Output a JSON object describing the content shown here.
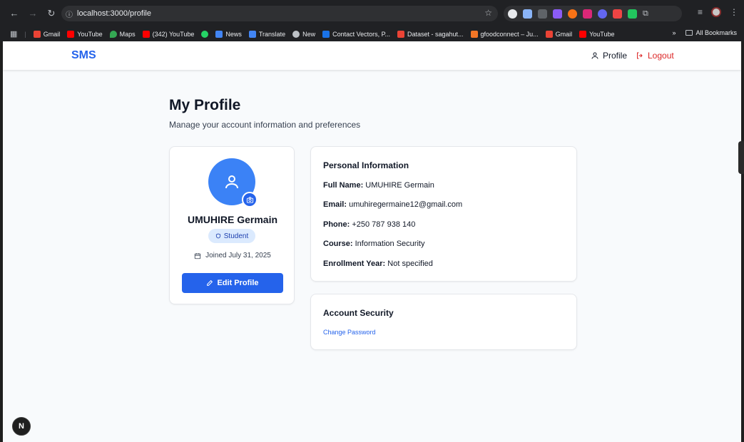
{
  "browser": {
    "url": "localhost:3000/profile",
    "bookmarks": [
      {
        "label": "Gmail",
        "icon": "gmail-icon",
        "color": "#ea4335"
      },
      {
        "label": "YouTube",
        "icon": "youtube-icon",
        "color": "#ff0000"
      },
      {
        "label": "Maps",
        "icon": "maps-icon",
        "color": "#34a853"
      },
      {
        "label": "(342) YouTube",
        "icon": "youtube-icon",
        "color": "#ff0000"
      },
      {
        "label": "",
        "icon": "whatsapp-icon",
        "color": "#25d366"
      },
      {
        "label": "News",
        "icon": "news-icon",
        "color": "#4285f4"
      },
      {
        "label": "Translate",
        "icon": "translate-icon",
        "color": "#4285f4"
      },
      {
        "label": "New",
        "icon": "globe-icon",
        "color": "#bdc1c6"
      },
      {
        "label": "Contact Vectors, P...",
        "icon": "freepik-icon",
        "color": "#1a73e8"
      },
      {
        "label": "Dataset - sagahut...",
        "icon": "gmail-icon",
        "color": "#ea4335"
      },
      {
        "label": "gfoodconnect – Ju...",
        "icon": "jupyter-icon",
        "color": "#f37626"
      },
      {
        "label": "Gmail",
        "icon": "gmail-icon",
        "color": "#ea4335"
      },
      {
        "label": "YouTube",
        "icon": "youtube-icon",
        "color": "#ff0000"
      }
    ],
    "more_label": "»",
    "all_bookmarks_label": "All Bookmarks"
  },
  "app": {
    "logo": "SMS",
    "nav_profile": "Profile",
    "nav_logout": "Logout",
    "page_title": "My Profile",
    "page_subtitle": "Manage your account information and preferences",
    "user": {
      "name": "UMUHIRE Germain",
      "role": "Student",
      "joined": "Joined July 31, 2025"
    },
    "edit_button": "Edit Profile",
    "personal_info": {
      "title": "Personal Information",
      "fields": [
        {
          "label": "Full Name:",
          "value": "UMUHIRE Germain"
        },
        {
          "label": "Email:",
          "value": "umuhiregermaine12@gmail.com"
        },
        {
          "label": "Phone:",
          "value": "+250 787 938 140"
        },
        {
          "label": "Course:",
          "value": "Information Security"
        },
        {
          "label": "Enrollment Year:",
          "value": "Not specified"
        }
      ]
    },
    "security": {
      "title": "Account Security",
      "change_password": "Change Password"
    },
    "dev_badge": "N"
  },
  "colors": {
    "primary": "#2563eb",
    "logout": "#dc2626",
    "badge_bg": "#dbeafe"
  }
}
